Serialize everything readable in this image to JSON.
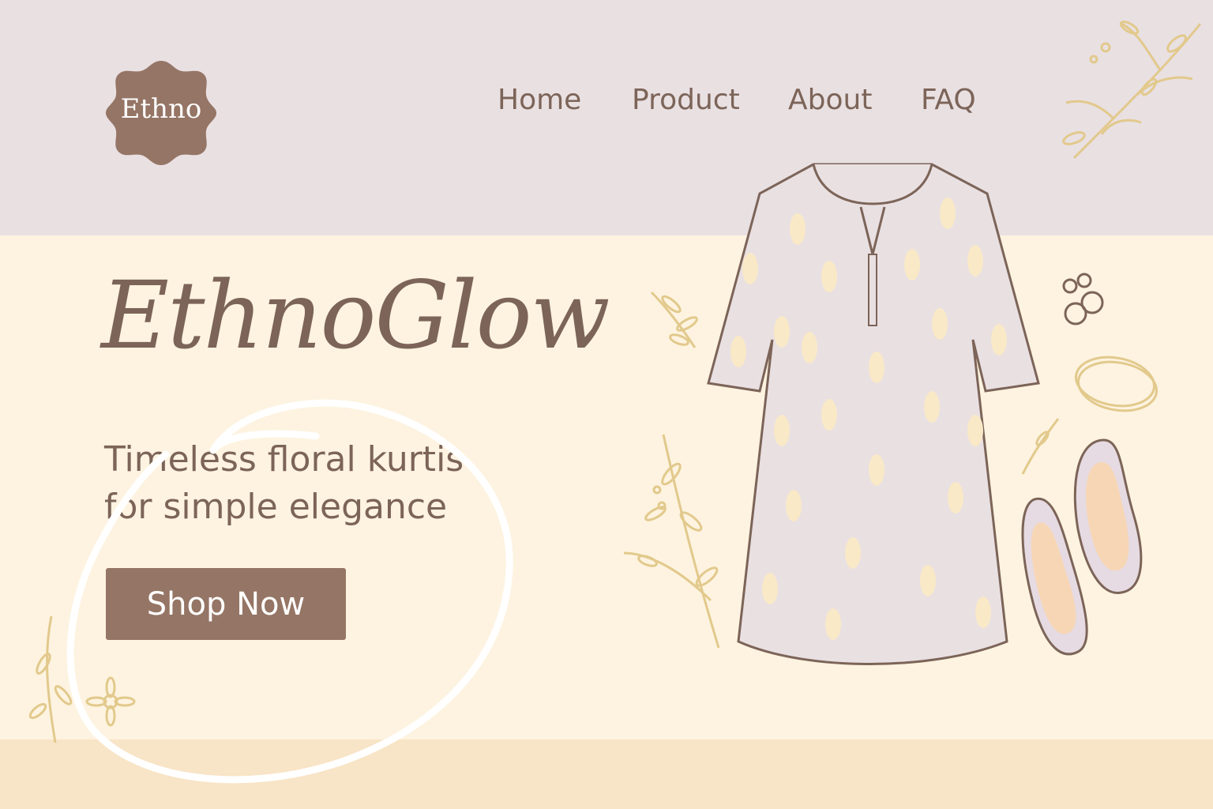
{
  "brand": {
    "logo_text": "Ethno"
  },
  "nav": {
    "items": [
      {
        "label": "Home"
      },
      {
        "label": "Product"
      },
      {
        "label": "About"
      },
      {
        "label": "FAQ"
      }
    ]
  },
  "hero": {
    "title": "EthnoGlow",
    "tagline_line1": "Timeless floral kurtis",
    "tagline_line2": "for simple elegance",
    "cta_label": "Shop Now"
  },
  "colors": {
    "header_bg": "#e9e0e2",
    "hero_bg": "#fdf3e0",
    "footer_band": "#f8e4c6",
    "brand_brown": "#957565",
    "text_brown": "#7c6458",
    "gold_accent": "#e2c98c"
  },
  "icons": [
    "flower-badge-logo",
    "kurti-dress-illustration",
    "leaf-sprig-decoration",
    "bangles-icon",
    "rings-icon",
    "flat-shoes-icon"
  ],
  "annotation": {
    "type": "hand-drawn-circle",
    "target": "Shop Now"
  }
}
